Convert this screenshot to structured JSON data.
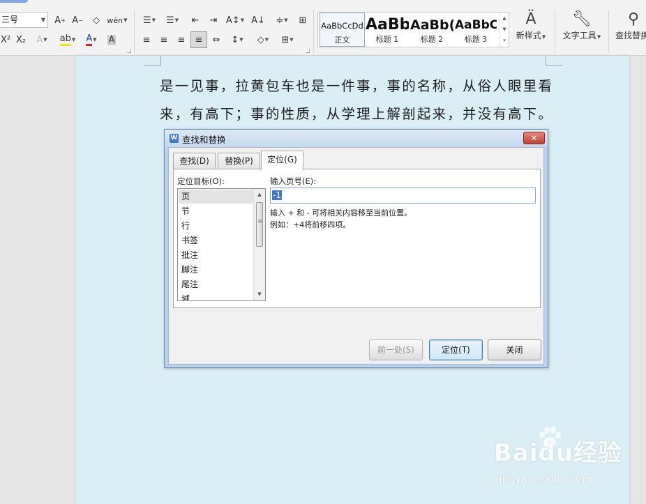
{
  "ribbon": {
    "font_size_value": "三号",
    "font_buttons": [
      "A⁺",
      "A⁻",
      "◇",
      "wén"
    ],
    "format_buttons": [
      "X²",
      "X₂",
      "A",
      "ab",
      "A",
      "A"
    ],
    "para_buttons_row1": [
      "☰",
      "☰",
      "⇤",
      "⇥",
      "A↕",
      "A↓",
      "≑",
      "⊞"
    ],
    "para_buttons_row2": [
      "≡",
      "≡",
      "≡",
      "≡",
      "⇔",
      "↕",
      "◇",
      "⊞"
    ],
    "styles": [
      {
        "sample": "AaBbCcDd",
        "label": "正文"
      },
      {
        "sample": "AaBb",
        "label": "标题 1"
      },
      {
        "sample": "AaBb(",
        "label": "标题 2"
      },
      {
        "sample": "AaBbC",
        "label": "标题 3"
      }
    ],
    "new_style_label": "新样式",
    "text_tools_label": "文字工具",
    "find_replace_label": "查找替换"
  },
  "document": {
    "lines": [
      "是一见事，拉黄包车也是一件事，事的名称，从俗人眼里看",
      "来，有高下；事的性质，从学理上解剖起来，并没有高下。"
    ]
  },
  "dialog": {
    "app_icon": "W",
    "title": "查找和替换",
    "close_symbol": "✕",
    "tabs": [
      {
        "label": "查找(D)"
      },
      {
        "label": "替换(P)"
      },
      {
        "label": "定位(G)"
      }
    ],
    "target_label": "定位目标(O):",
    "targets": [
      "页",
      "节",
      "行",
      "书签",
      "批注",
      "脚注",
      "尾注",
      "域"
    ],
    "selected_target": "页",
    "page_label": "输入页号(E):",
    "page_value": "-1",
    "hint_line1": "输入 + 和 - 可将相关内容移至当前位置。",
    "hint_line2": "例如：+4将前移四项。",
    "buttons": {
      "prev": "前一处(S)",
      "goto": "定位(T)",
      "close": "关闭"
    }
  },
  "watermark": {
    "logo": "Baidu经验",
    "url": "jingyan.baidu.com"
  }
}
